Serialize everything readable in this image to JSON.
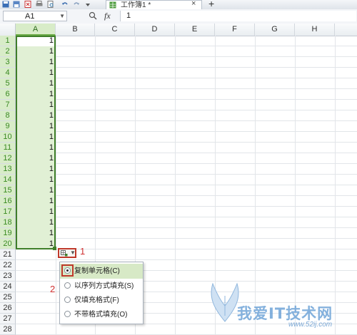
{
  "toolbar": {
    "quick_access_icons": [
      "save-icon",
      "save-as-icon",
      "pdf-icon",
      "print-icon",
      "print-preview-icon",
      "undo-icon",
      "redo-icon",
      "dropdown-icon"
    ],
    "document_tab": {
      "label": "工作簿1 *",
      "close": "×"
    },
    "new_tab": "+"
  },
  "formula_bar": {
    "name_box": "A1",
    "fx": "fx",
    "value": "1"
  },
  "grid": {
    "columns": [
      "A",
      "B",
      "C",
      "D",
      "E",
      "F",
      "G",
      "H"
    ],
    "rows": [
      "1",
      "2",
      "3",
      "4",
      "5",
      "6",
      "7",
      "8",
      "9",
      "10",
      "11",
      "12",
      "13",
      "14",
      "15",
      "16",
      "17",
      "18",
      "19",
      "20",
      "21",
      "22",
      "23",
      "24",
      "25",
      "26",
      "27",
      "28"
    ],
    "column_a_values": [
      "1",
      "1",
      "1",
      "1",
      "1",
      "1",
      "1",
      "1",
      "1",
      "1",
      "1",
      "1",
      "1",
      "1",
      "1",
      "1",
      "1",
      "1",
      "1",
      "1"
    ],
    "selection": "A1:A20",
    "selection_color": "#e1f0d5",
    "selection_border_color": "#3f7f2a"
  },
  "autofill": {
    "annotation_1": "1",
    "annotation_2": "2",
    "menu_items": [
      {
        "label": "复制单元格(C)",
        "selected": true
      },
      {
        "label": "以序列方式填充(S)",
        "selected": false
      },
      {
        "label": "仅填充格式(F)",
        "selected": false
      },
      {
        "label": "不带格式填充(O)",
        "selected": false
      }
    ],
    "highlight_color": "#d7e9c6",
    "annotation_color": "#c0392b"
  },
  "watermark": {
    "text": "我爱IT技术网",
    "url": "www.52ij.com"
  }
}
